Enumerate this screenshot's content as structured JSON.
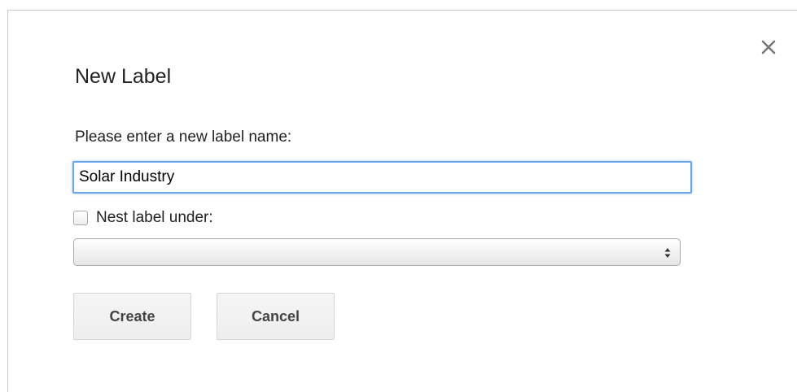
{
  "dialog": {
    "title": "New Label",
    "close_icon": "close-icon",
    "prompt": "Please enter a new label name:",
    "label_name_value": "Solar Industry",
    "nest_checkbox_checked": false,
    "nest_label": "Nest label under:",
    "parent_select_value": "",
    "create_button": "Create",
    "cancel_button": "Cancel"
  },
  "colors": {
    "input_focus_border": "#6ea5e6",
    "button_background": "#f5f5f5",
    "button_text": "#444444"
  }
}
